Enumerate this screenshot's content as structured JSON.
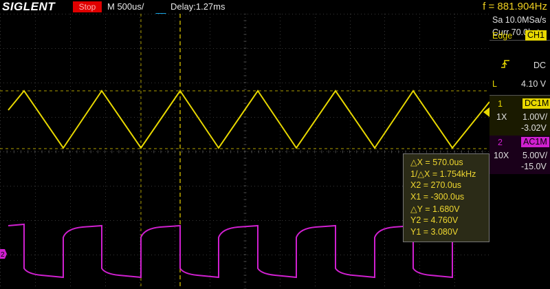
{
  "header": {
    "brand": "SIGLENT",
    "run_state": "Stop",
    "timebase": "M 500us/",
    "delay": "Delay:1.27ms",
    "frequency": "f = 881.904Hz"
  },
  "acquisition": {
    "sample_rate": "Sa 10.0MSa/s",
    "memory_depth": "Curr 70.0kpts"
  },
  "trigger": {
    "type_label": "Edge",
    "source": "CH1",
    "coupling": "DC",
    "level_label": "L",
    "level_value": "4.10 V"
  },
  "channel1": {
    "number": "1",
    "coupling": "DC1M",
    "probe": "1X",
    "scale": "1.00V/",
    "offset": "-3.02V"
  },
  "channel2": {
    "number": "2",
    "coupling": "AC1M",
    "probe": "10X",
    "scale": "5.00V/",
    "offset": "-15.0V"
  },
  "cursors": {
    "delta_x": "△X = 570.0us",
    "inv_delta_x": "1/△X = 1.754kHz",
    "x2": "X2 = 270.0us",
    "x1": "X1 = -300.0us",
    "delta_y": "△Y = 1.680V",
    "y2": "Y2 = 4.760V",
    "y1": "Y1 = 3.080V"
  },
  "markers": {
    "ch2_ground": "2"
  },
  "colors": {
    "ch1": "#e8d800",
    "ch2": "#d020d0",
    "trigger_marker": "#18a8e8",
    "stop_badge": "#e00000",
    "frequency_text": "#f0d020"
  },
  "icons": {
    "trigger_slope": "rising-edge-icon"
  }
}
